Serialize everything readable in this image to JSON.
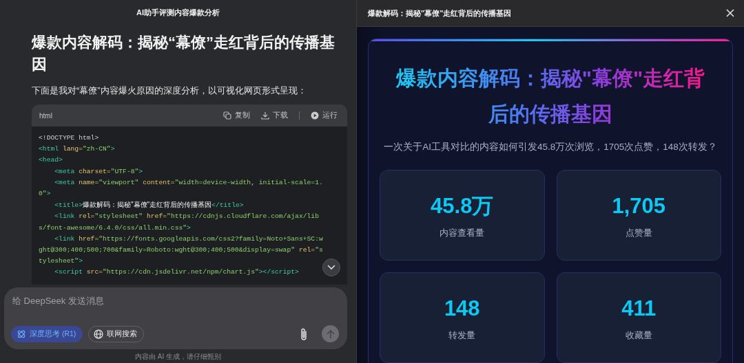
{
  "chat": {
    "title": "AI助手评测内容爆款分析",
    "heading": "爆款内容解码：揭秘“幕僚”走红背后的传播基因",
    "intro": "下面是我对“幕僚”内容爆火原因的深度分析，以可视化网页形式呈现：",
    "code_block": {
      "language": "html",
      "actions": [
        {
          "kind": "copy",
          "label": "复制"
        },
        {
          "kind": "download",
          "label": "下载"
        },
        {
          "kind": "run",
          "label": "运行"
        }
      ],
      "lines": [
        {
          "tokens": [
            {
              "kind": "plain",
              "text": "<!DOCTYPE html>"
            }
          ]
        },
        {
          "tokens": [
            {
              "kind": "tag",
              "text": "<html"
            },
            {
              "kind": "attr",
              "text": " lang="
            },
            {
              "kind": "str",
              "text": "\"zh-CN\""
            },
            {
              "kind": "tag",
              "text": ">"
            }
          ]
        },
        {
          "tokens": [
            {
              "kind": "tag",
              "text": "<head>"
            }
          ]
        },
        {
          "tokens": [
            {
              "kind": "tag",
              "text": "    <meta"
            },
            {
              "kind": "attr",
              "text": " charset="
            },
            {
              "kind": "str",
              "text": "\"UTF-8\""
            },
            {
              "kind": "tag",
              "text": ">"
            }
          ]
        },
        {
          "tokens": [
            {
              "kind": "tag",
              "text": "    <meta"
            },
            {
              "kind": "attr",
              "text": " name="
            },
            {
              "kind": "str",
              "text": "\"viewport\""
            },
            {
              "kind": "attr",
              "text": " content="
            },
            {
              "kind": "str",
              "text": "\"width=device-width, initial-scale=1."
            }
          ]
        },
        {
          "tokens": [
            {
              "kind": "str",
              "text": "0\""
            },
            {
              "kind": "tag",
              "text": ">"
            }
          ]
        },
        {
          "tokens": [
            {
              "kind": "tag",
              "text": "    <title>"
            },
            {
              "kind": "text",
              "text": "爆款解码：揭秘\"幕僚\"走红背后的传播基因"
            },
            {
              "kind": "tag",
              "text": "</title>"
            }
          ]
        },
        {
          "tokens": [
            {
              "kind": "tag",
              "text": "    <link"
            },
            {
              "kind": "attr",
              "text": " rel="
            },
            {
              "kind": "str",
              "text": "\"stylesheet\""
            },
            {
              "kind": "attr",
              "text": " href="
            },
            {
              "kind": "str",
              "text": "\"https://cdnjs.cloudflare.com/ajax/lib"
            }
          ]
        },
        {
          "tokens": [
            {
              "kind": "str",
              "text": "s/font-awesome/6.4.0/css/all.min.css\""
            },
            {
              "kind": "tag",
              "text": ">"
            }
          ]
        },
        {
          "tokens": [
            {
              "kind": "tag",
              "text": "    <link"
            },
            {
              "kind": "attr",
              "text": " href="
            },
            {
              "kind": "str",
              "text": "\"https://fonts.googleapis.com/css2?family=Noto+Sans+SC:w"
            }
          ]
        },
        {
          "tokens": [
            {
              "kind": "str",
              "text": "ght@300;400;500;700&family=Roboto:wght@300;400;500&display=swap\""
            },
            {
              "kind": "attr",
              "text": " rel="
            },
            {
              "kind": "str",
              "text": "\"s"
            }
          ]
        },
        {
          "tokens": [
            {
              "kind": "str",
              "text": "tylesheet\""
            },
            {
              "kind": "tag",
              "text": ">"
            }
          ]
        },
        {
          "tokens": [
            {
              "kind": "tag",
              "text": "    <script"
            },
            {
              "kind": "attr",
              "text": " src="
            },
            {
              "kind": "str",
              "text": "\"https://cdn.jsdelivr.net/npm/chart.js\""
            },
            {
              "kind": "tag",
              "text": "></script>"
            }
          ]
        }
      ]
    },
    "composer": {
      "placeholder": "给 DeepSeek 发送消息",
      "toggles": [
        {
          "kind": "deep-think",
          "label": "深度思考 (R1)",
          "on": true
        },
        {
          "kind": "web-search",
          "label": "联网搜索",
          "on": false
        }
      ]
    },
    "disclaimer": "内容由 AI 生成，请仔细甄别"
  },
  "preview": {
    "title": "爆款解码：揭秘\"幕僚\"走红背后的传播基因",
    "heading": "爆款内容解码：揭秘\"幕僚\"走红背后的传播基因",
    "subtitle": "一次关于AI工具对比的内容如何引发45.8万次浏览，1705次点赞，148次转发？",
    "stats": [
      {
        "value": "45.8万",
        "label": "内容查看量"
      },
      {
        "value": "1,705",
        "label": "点赞量"
      },
      {
        "value": "148",
        "label": "转发量"
      },
      {
        "value": "411",
        "label": "收藏量"
      }
    ]
  }
}
